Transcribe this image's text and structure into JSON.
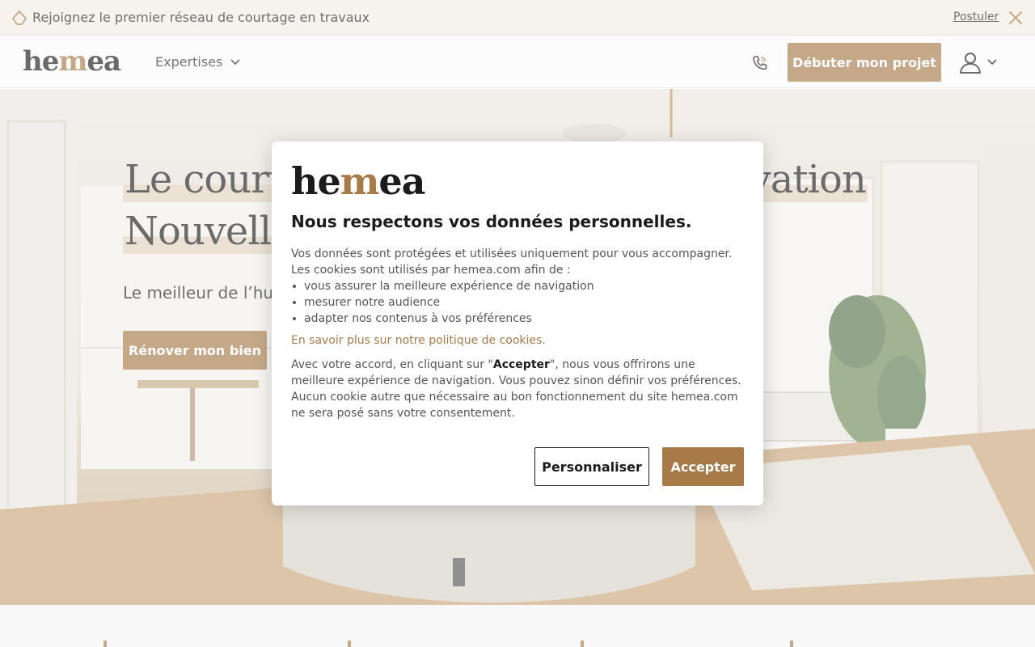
{
  "announcement": {
    "text": "Rejoignez le premier réseau de courtage en travaux",
    "link_label": "Postuler",
    "leading_icon": "house-outline-icon",
    "close_icon": "close-icon"
  },
  "header": {
    "logo": {
      "pre": "he",
      "accent": "m",
      "post": "ea"
    },
    "nav_expertises_label": "Expertises",
    "phone_icon": "phone-icon",
    "start_button_label": "Débuter mon projet",
    "user_icon": "user-icon"
  },
  "hero": {
    "title_line1": "Le courtier en travaux de la rénovation",
    "title_line2": "Nouvelle génération",
    "subtitle": "Le meilleur de l’humain et de la tech pour vos travaux",
    "cta_label": "Rénover mon bien"
  },
  "modal": {
    "logo": {
      "pre": "he",
      "accent": "m",
      "post": "ea"
    },
    "title": "Nous respectons vos données personnelles.",
    "intro": "Vos données sont protégées et utilisées uniquement pour vous accompagner. Les cookies sont utilisés par hemea.com afin de :",
    "items": [
      "vous assurer la meilleure expérience de navigation",
      "mesurer notre audience",
      "adapter nos contenus à vos préférences"
    ],
    "policy_link": "En savoir plus sur notre politique de cookies.",
    "consent_before": "Avec votre accord, en cliquant sur \"",
    "consent_bold": "Accepter",
    "consent_after": "\", nous vous offrirons une meilleure expérience de navigation. Vous pouvez sinon définir vos préférences. Aucun cookie autre que nécessaire au bon fonctionnement du site hemea.com ne sera posé sans votre consentement.",
    "personalize_label": "Personnaliser",
    "accept_label": "Accepter"
  },
  "colors": {
    "accent": "#a77a47",
    "text_dark": "#1b1b1b",
    "announcement_bg": "#f2ede4"
  }
}
